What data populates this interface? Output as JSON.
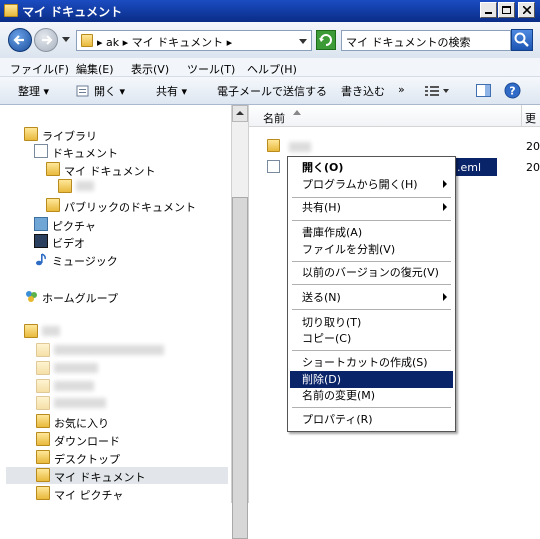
{
  "window": {
    "title": "マイ ドキュメント"
  },
  "address": {
    "path": "▸ ak ▸ マイ ドキュメント ▸",
    "search_placeholder": "マイ ドキュメントの検索"
  },
  "menu": [
    "ファイル(F)",
    "編集(E)",
    "表示(V)",
    "ツール(T)",
    "ヘルプ(H)"
  ],
  "commands": {
    "organize": "整理 ▾",
    "open": "開く ▾",
    "share": "共有 ▾",
    "email": "電子メールで送信する",
    "burn": "書き込む",
    "more": "»"
  },
  "nav": {
    "libraries": "ライブラリ",
    "documents": "ドキュメント",
    "my_documents": "マイ ドキュメント",
    "public_documents": "パブリックのドキュメント",
    "pictures": "ピクチャ",
    "videos": "ビデオ",
    "music": "ミュージック",
    "homegroup": "ホームグループ",
    "favorites": "お気に入り",
    "downloads": "ダウンロード",
    "desktop": "デスクトップ",
    "my_documents2": "マイ ドキュメント",
    "my_pictures": "マイ ピクチャ"
  },
  "files": {
    "header_name": "名前",
    "header_date": "更",
    "rows": [
      {
        "name": "",
        "date": "20"
      },
      {
        "name": ".eml",
        "date": "20"
      }
    ]
  },
  "context_menu": {
    "open": "開く(O)",
    "open_with": "プログラムから開く(H)",
    "share": "共有(H)",
    "create_archive": "書庫作成(A)",
    "split_file": "ファイルを分割(V)",
    "restore_versions": "以前のバージョンの復元(V)",
    "send_to": "送る(N)",
    "cut": "切り取り(T)",
    "copy": "コピー(C)",
    "create_shortcut": "ショートカットの作成(S)",
    "delete": "削除(D)",
    "rename": "名前の変更(M)",
    "properties": "プロパティ(R)"
  }
}
